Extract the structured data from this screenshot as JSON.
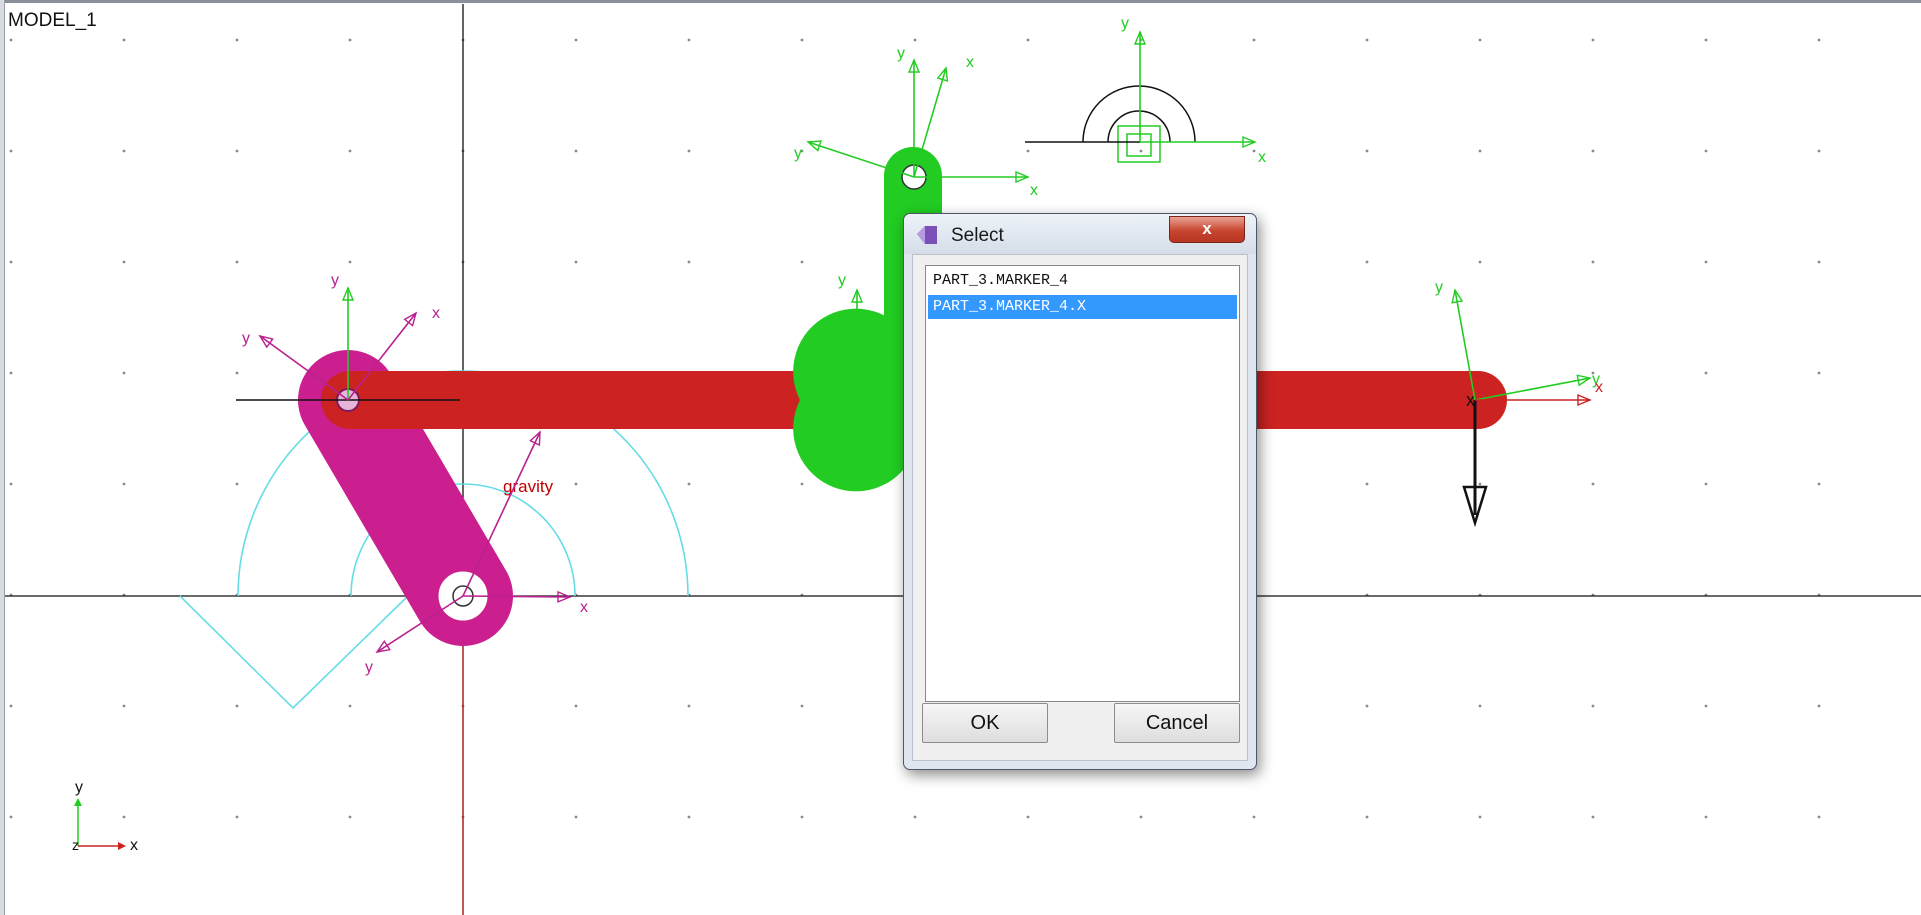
{
  "model": {
    "name": "MODEL_1"
  },
  "scene": {
    "gravity_label": "gravity",
    "axis_labels": {
      "x": "x",
      "y": "y",
      "z": "z"
    },
    "colors": {
      "part_red": "#cc2222",
      "part_magenta": "#cc1f8f",
      "part_green": "#22cc22",
      "marker_green": "#22cc22",
      "marker_magenta": "#b8218f",
      "gravity_cyan": "#66dde6",
      "grid_dot": "#8a8a8a",
      "axis_line": "#111111"
    }
  },
  "dialog": {
    "title": "Select",
    "close_label": "x",
    "items": [
      {
        "label": "PART_3.MARKER_4",
        "selected": false
      },
      {
        "label": "PART_3.MARKER_4.X",
        "selected": true
      }
    ],
    "ok_label": "OK",
    "cancel_label": "Cancel"
  }
}
